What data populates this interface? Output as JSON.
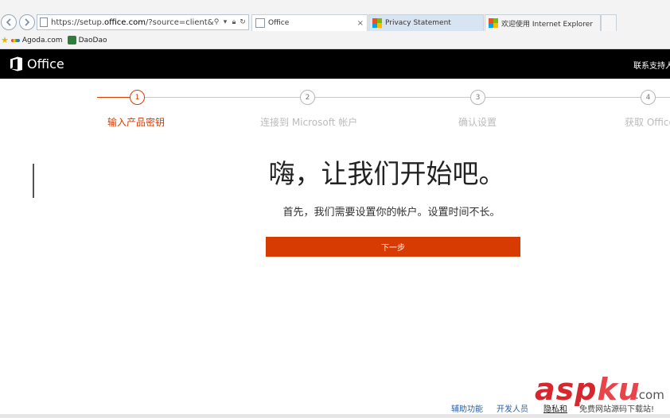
{
  "browser": {
    "url_prefix": "https://setup.",
    "url_domain": "office.com",
    "url_suffix": "/?source=client&value=",
    "tabs": [
      {
        "label": "Office",
        "close": "×"
      },
      {
        "label": "Privacy Statement"
      },
      {
        "label": "欢迎使用 Internet Explorer"
      }
    ],
    "favorites": [
      {
        "label": "Agoda.com"
      },
      {
        "label": "DaoDao"
      }
    ]
  },
  "header": {
    "brand": "Office",
    "contact": "联系支持人"
  },
  "steps": [
    {
      "number": "1",
      "label": "输入产品密钥",
      "active": true
    },
    {
      "number": "2",
      "label": "连接到 Microsoft 帐户",
      "active": false
    },
    {
      "number": "3",
      "label": "确认设置",
      "active": false
    },
    {
      "number": "4",
      "label": "获取 Office",
      "active": false
    }
  ],
  "main": {
    "headline": "嗨，让我们开始吧。",
    "subline": "首先，我们需要设置你的帐户。设置时间不长。",
    "next_button": "下一步"
  },
  "footer": {
    "accessibility": "辅助功能",
    "developers": "开发人员",
    "privacy": "隐私和"
  },
  "watermark": {
    "brand_a": "asp",
    "brand_b": "ku",
    "domain": ".com",
    "tagline": "免费网站源码下载站!"
  },
  "colors": {
    "accent": "#d83b01",
    "header_bg": "#000000",
    "link": "#2a5fa6"
  }
}
